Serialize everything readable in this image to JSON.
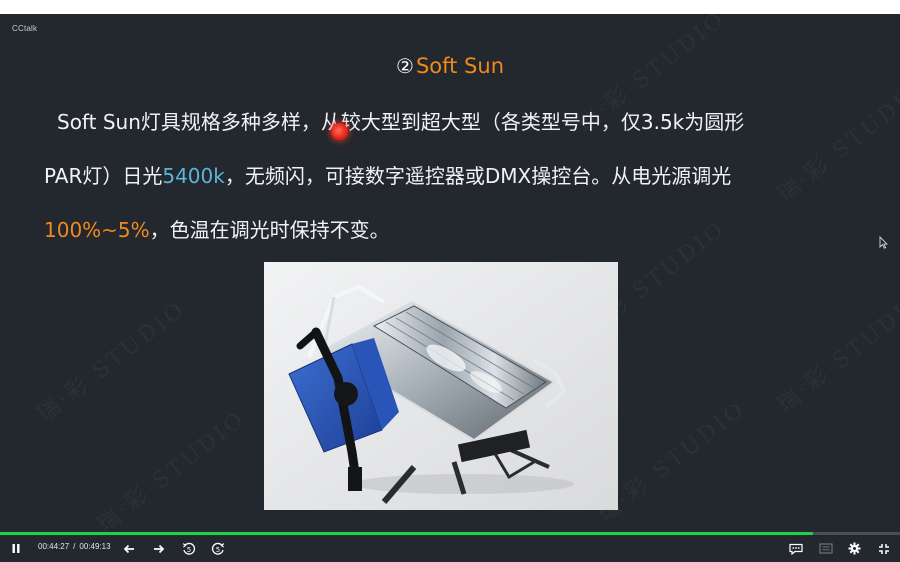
{
  "app": {
    "name": "CCtalk"
  },
  "slide": {
    "title_number": "②",
    "title": "Soft Sun",
    "line1": "Soft Sun灯具规格多种多样，从较大型到超大型（各类型号中，仅3.5k为圆形",
    "line2_a": "PAR灯）日光",
    "line2_highlight": "5400k",
    "line2_b": "，无频闪，可接数字遥控器或DMX操控台。从电光源调光",
    "line3_highlight": "100%~5%",
    "line3_b": "，色温在调光时保持不变。",
    "watermark_text": "瑞·彩 STUDIO"
  },
  "player": {
    "current_time": "00:44:27",
    "separator": "/",
    "total_time": "00:49:13",
    "progress": 0.903,
    "icons": {
      "play_pause": "pause-icon",
      "prev": "arrow-left-icon",
      "next": "arrow-right-icon",
      "rewind": "rewind-5-icon",
      "forward": "forward-5-icon",
      "chat": "chat-bubble-icon",
      "subtitle": "subtitle-icon",
      "settings": "gear-icon",
      "fullscreen": "exit-fullscreen-icon"
    },
    "skip_seconds": "5"
  },
  "colors": {
    "background": "#23272e",
    "accent_orange": "#ef8a1b",
    "accent_blue": "#5fb3d6",
    "progress_green": "#1fd04b",
    "laser_red": "#e5271a"
  }
}
